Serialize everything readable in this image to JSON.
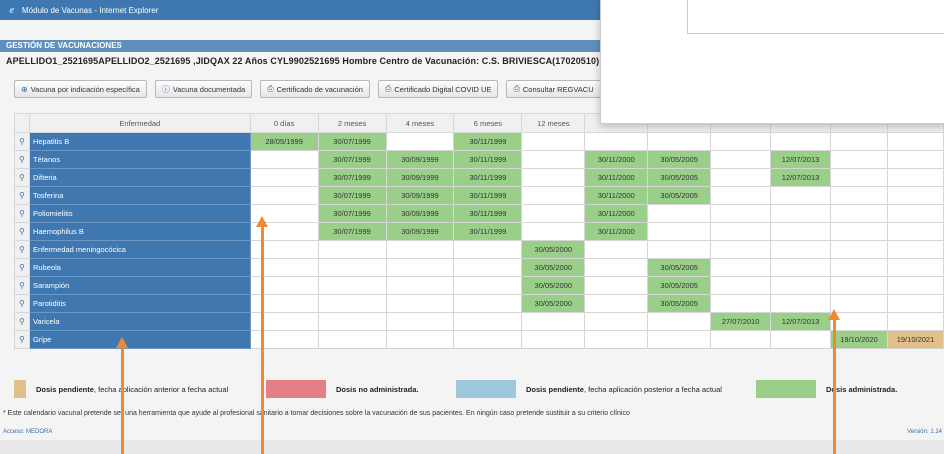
{
  "window": {
    "title": "Módulo de Vacunas - Internet Explorer"
  },
  "panel": {
    "title": "GESTIÓN DE VACUNACIONES"
  },
  "patient": {
    "line": "APELLIDO1_2521695APELLIDO2_2521695 ,JIDQAX   22 Años   CYL9902521695   Hombre   Centro de Vacunación: C.S. BRIVIESCA(17020510)"
  },
  "buttons": [
    {
      "label": "Vacuna por indicación específica",
      "icon": "plus-circle-icon"
    },
    {
      "label": "Vacuna documentada",
      "icon": "info-icon"
    },
    {
      "label": "Certificado de vacunación",
      "icon": "print-icon"
    },
    {
      "label": "Certificado Digital COVID UE",
      "icon": "print-icon"
    },
    {
      "label": "Consultar REGVACU",
      "icon": "print-icon"
    }
  ],
  "table": {
    "headers": [
      "Enfermedad",
      "0 días",
      "2 meses",
      "4 meses",
      "6 meses",
      "12 meses",
      "",
      "",
      "",
      "",
      "",
      ""
    ],
    "rows": [
      {
        "name": "Hepatitis B",
        "cells": [
          "28/05/1999",
          "30/07/1999",
          "",
          "30/11/1999",
          "",
          "",
          "",
          "",
          "",
          "",
          ""
        ]
      },
      {
        "name": "Tétanos",
        "cells": [
          "",
          "30/07/1999",
          "30/09/1999",
          "30/11/1999",
          "",
          "30/11/2000",
          "30/05/2005",
          "",
          "12/07/2013",
          "",
          ""
        ]
      },
      {
        "name": "Difteria",
        "cells": [
          "",
          "30/07/1999",
          "30/09/1999",
          "30/11/1999",
          "",
          "30/11/2000",
          "30/05/2005",
          "",
          "12/07/2013",
          "",
          ""
        ]
      },
      {
        "name": "Tosferina",
        "cells": [
          "",
          "30/07/1999",
          "30/09/1999",
          "30/11/1999",
          "",
          "30/11/2000",
          "30/05/2005",
          "",
          "",
          "",
          ""
        ]
      },
      {
        "name": "Poliomielitis",
        "cells": [
          "",
          "30/07/1999",
          "30/09/1999",
          "30/11/1999",
          "",
          "30/11/2000",
          "",
          "",
          "",
          "",
          ""
        ]
      },
      {
        "name": "Haemophilus B",
        "cells": [
          "",
          "30/07/1999",
          "30/09/1999",
          "30/11/1999",
          "",
          "30/11/2000",
          "",
          "",
          "",
          "",
          ""
        ]
      },
      {
        "name": "Enfermedad meningocócica",
        "cells": [
          "",
          "",
          "",
          "",
          "30/05/2000",
          "",
          "",
          "",
          "",
          "",
          ""
        ]
      },
      {
        "name": "Rubeola",
        "cells": [
          "",
          "",
          "",
          "",
          "30/05/2000",
          "",
          "30/05/2005",
          "",
          "",
          "",
          ""
        ]
      },
      {
        "name": "Sarampión",
        "cells": [
          "",
          "",
          "",
          "",
          "30/05/2000",
          "",
          "30/05/2005",
          "",
          "",
          "",
          ""
        ]
      },
      {
        "name": "Parotiditis",
        "cells": [
          "",
          "",
          "",
          "",
          "30/05/2000",
          "",
          "30/05/2005",
          "",
          "",
          "",
          ""
        ]
      },
      {
        "name": "Varicela",
        "cells": [
          "",
          "",
          "",
          "",
          "",
          "",
          "",
          "27/07/2010",
          "12/07/2013",
          "",
          ""
        ]
      },
      {
        "name": "Gripe",
        "cells": [
          "",
          "",
          "",
          "",
          "",
          "",
          "",
          "",
          "",
          "19/10/2020",
          "19/10/2021"
        ]
      }
    ]
  },
  "legend": [
    {
      "color": "#e0c088",
      "bold": "Dosis pendiente",
      "rest": ", fecha aplicación anterior a fecha actual"
    },
    {
      "color": "#e57f86",
      "bold": "Dosis no administrada.",
      "rest": ""
    },
    {
      "color": "#9fc7dc",
      "bold": "Dosis pendiente",
      "rest": ", fecha aplicación posterior a fecha actual"
    },
    {
      "color": "#9acf8a",
      "bold": "Dosis administrada.",
      "rest": ""
    }
  ],
  "note": "* Este calendario vacunal pretende ser una herramienta que ayude al profesional sanitario a tomar decisiones sobre la vacunación de sus pacientes. En ningún caso pretende sustituir a su criterio clínico",
  "footer": {
    "left": "Acceso: MEDORA",
    "right": "Versión: 1.14"
  },
  "colors": {
    "header_blue": "#3f78b0",
    "administered": "#9acf8a",
    "pending_past": "#e0c088",
    "annotation_arrow": "#f08a32"
  }
}
